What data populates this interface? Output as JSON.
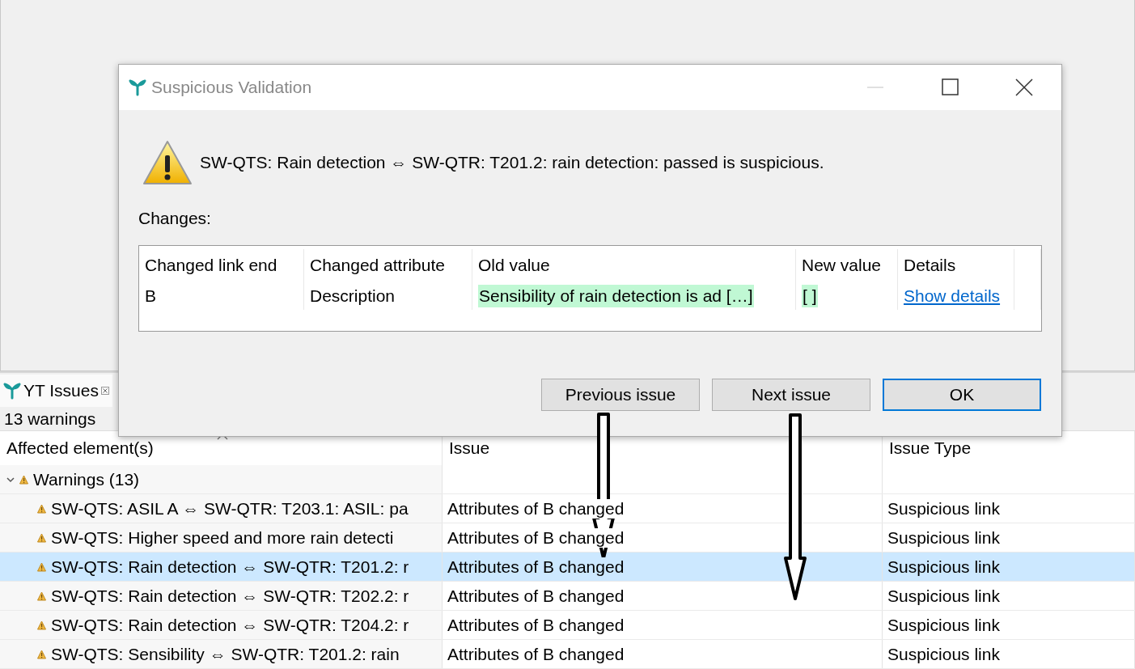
{
  "dialog": {
    "title": "Suspicious Validation",
    "message": "SW-QTS: Rain detection ⇔ SW-QTR: T201.2: rain detection: passed is suspicious.",
    "changes_label": "Changes:",
    "table": {
      "columns": [
        "Changed link end",
        "Changed attribute",
        "Old value",
        "New value",
        "Details"
      ],
      "rows": [
        {
          "cells": [
            {
              "kind": "text",
              "text": "B",
              "highlighted": false
            },
            {
              "kind": "text",
              "text": "Description",
              "highlighted": false
            },
            {
              "kind": "text",
              "text": "Sensibility of rain detection is ad […]",
              "highlighted": true
            },
            {
              "kind": "text",
              "text": "[ ]",
              "highlighted": true
            },
            {
              "kind": "link",
              "text": "Show details",
              "highlighted": false
            }
          ]
        }
      ]
    },
    "buttons": [
      {
        "label": "Previous issue",
        "default": false
      },
      {
        "label": "Next issue",
        "default": false
      },
      {
        "label": "OK",
        "default": true
      }
    ]
  },
  "issues_view": {
    "tab_title": "YT Issues",
    "summary": "13 warnings",
    "columns": [
      "Affected element(s)",
      "Issue",
      "Issue Type"
    ],
    "groups": [
      {
        "label": "Warnings (13)",
        "expanded": true,
        "children": [
          {
            "element": "SW-QTS: ASIL A ⇔ SW-QTR: T203.1: ASIL: pa",
            "issue": "Attributes of B changed",
            "type": "Suspicious link",
            "selected": false
          },
          {
            "element": "SW-QTS: Higher speed and more rain detecti",
            "issue": "Attributes of B changed",
            "type": "Suspicious link",
            "selected": false
          },
          {
            "element": "SW-QTS: Rain detection ⇔ SW-QTR: T201.2: r",
            "issue": "Attributes of B changed",
            "type": "Suspicious link",
            "selected": true
          },
          {
            "element": "SW-QTS: Rain detection ⇔ SW-QTR: T202.2: r",
            "issue": "Attributes of B changed",
            "type": "Suspicious link",
            "selected": false
          },
          {
            "element": "SW-QTS: Rain detection ⇔ SW-QTR: T204.2: r",
            "issue": "Attributes of B changed",
            "type": "Suspicious link",
            "selected": false
          },
          {
            "element": "SW-QTS: Sensibility ⇔ SW-QTR: T201.2: rain",
            "issue": "Attributes of B changed",
            "type": "Suspicious link",
            "selected": false
          }
        ]
      }
    ]
  }
}
